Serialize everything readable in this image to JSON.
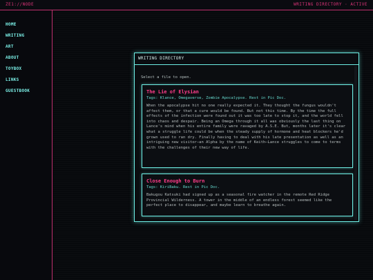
{
  "topbar": {
    "brand": "ZE1://NODE",
    "status": "WRITING DIRECTORY · ACTIVE"
  },
  "sidebar": {
    "items": [
      {
        "label": "HOME"
      },
      {
        "label": "WRITING"
      },
      {
        "label": "ART"
      },
      {
        "label": "ABOUT"
      },
      {
        "label": "TOYBOX"
      },
      {
        "label": "LINKS"
      },
      {
        "label": "GUESTBOOK"
      }
    ]
  },
  "panel": {
    "title": "WRITING DIRECTORY",
    "hint": "Select a file to open.",
    "entries": [
      {
        "title": "The Lie of Elysian",
        "tags": "Tags: Klance, Omegaverse, Zombie Apocalypse. Rest in Pic Doc.",
        "description": "When the apocalypse hit no one really expected it. They thought the fungus wouldn't affect them, or that a cure would be found. But not this time. By the time the full effects of the infection were found out it was too late to stop it, and the world fell into chaos and despair. Being an Omega through it all was obviously the last thing on Lance's mind when his entire family were ravaged by A.S.E. But, months later it's clear what a struggle life could be when the steady supply of hormone and heat blockers he'd grown used to ran dry. Finally having to deal with his late presentation as well as an intriguing new visitor—an Alpha by the name of Keith—Lance struggles to come to terms with the challenges of their new way of life."
      },
      {
        "title": "Close Enough to Burn",
        "tags": "Tags: KiriBaku. Rest in Pic Doc.",
        "description": "Bakugou Katsuki had signed up as a seasonal fire watcher in the remote Red Ridge Provincial Wilderness. A tower in the middle of an endless forest seemed like the perfect place to disappear, and maybe learn to breathe again."
      }
    ]
  },
  "colors": {
    "accent_pink": "#e0357b",
    "accent_cyan": "#6ff0e6",
    "background": "#07090c"
  }
}
